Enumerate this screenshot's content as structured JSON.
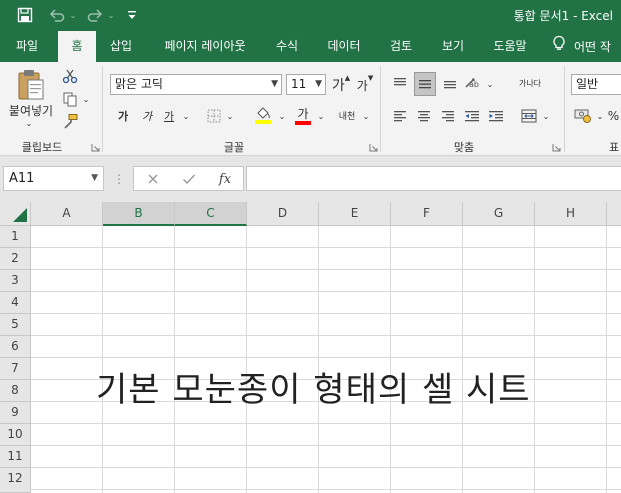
{
  "window": {
    "title": "통합 문서1  -  Excel"
  },
  "quick_access": [
    "save-icon",
    "undo-icon",
    "redo-icon",
    "customize-icon"
  ],
  "tabs": [
    {
      "label": "파일"
    },
    {
      "label": "홈"
    },
    {
      "label": "삽입"
    },
    {
      "label": "페이지 레이아웃"
    },
    {
      "label": "수식"
    },
    {
      "label": "데이터"
    },
    {
      "label": "검토"
    },
    {
      "label": "보기"
    },
    {
      "label": "도움말"
    }
  ],
  "active_tab": "홈",
  "tell_me": "어떤 작",
  "ribbon": {
    "clipboard": {
      "label": "클립보드",
      "paste_label": "붙여넣기"
    },
    "font": {
      "label": "글꼴",
      "font_name": "맑은 고딕",
      "font_size": "11",
      "grow": "가",
      "shrink": "가",
      "bold": "가",
      "italic": "가",
      "underline": "가",
      "font_color_glyph": "가",
      "phonetic": "내천",
      "fill_color": "#ffff00",
      "font_color": "#ff0000"
    },
    "alignment": {
      "label": "맞춤",
      "wrap": "가나다"
    },
    "number": {
      "label": "표",
      "format": "일반"
    }
  },
  "formula_bar": {
    "name_box": "A11",
    "fx": "fx",
    "value": ""
  },
  "grid": {
    "columns": [
      "A",
      "B",
      "C",
      "D",
      "E",
      "F",
      "G",
      "H"
    ],
    "selected_columns": [
      "B",
      "C"
    ],
    "rows": [
      "1",
      "2",
      "3",
      "4",
      "5",
      "6",
      "7",
      "8",
      "9",
      "10",
      "11",
      "12"
    ]
  },
  "overlay_text": "기본 모눈종이 형태의 셀 시트",
  "colors": {
    "brand": "#217346",
    "ribbon_bg": "#f3f3f3",
    "header_bg": "#e6e6e6",
    "gridline": "#dadada"
  }
}
